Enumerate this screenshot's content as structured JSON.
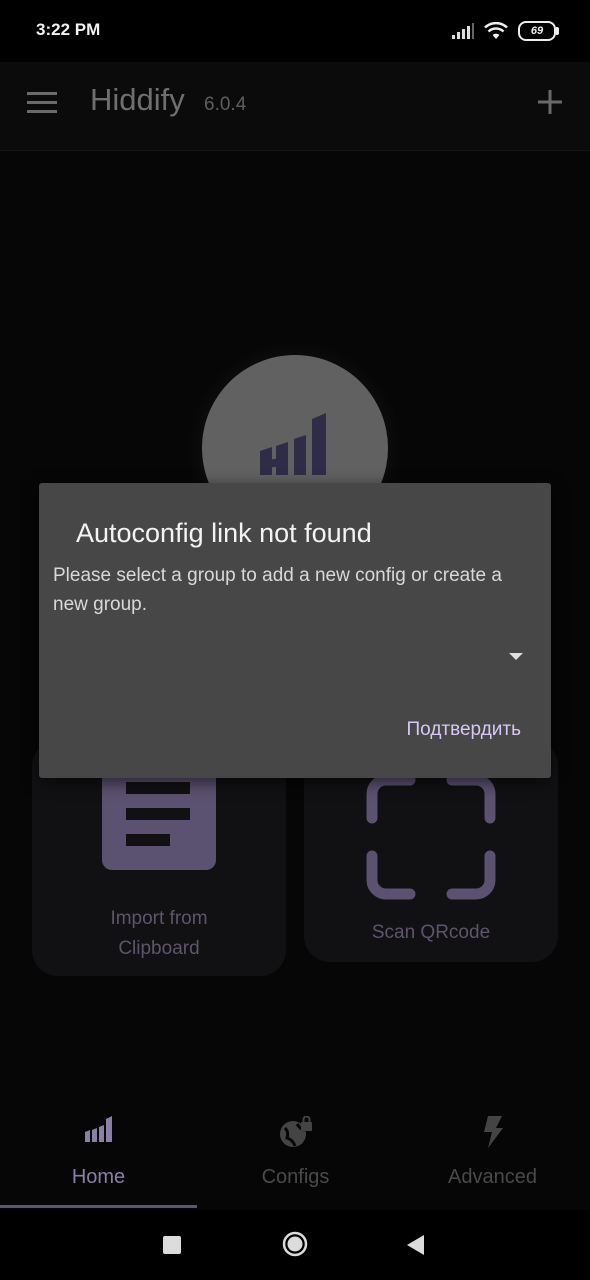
{
  "status_bar": {
    "time": "3:22 PM",
    "battery": "69"
  },
  "app_bar": {
    "title": "Hiddify",
    "version": "6.0.4"
  },
  "cards": {
    "clipboard_label_line1": "Import from",
    "clipboard_label_line2": "Clipboard",
    "qr_label": "Scan QRcode"
  },
  "dialog": {
    "title": "Autoconfig link not found",
    "message": "Please select a group to add a new config or create a new group.",
    "selected_group": "",
    "confirm_label": "Подтвердить"
  },
  "bottom_nav": {
    "items": [
      {
        "label": "Home",
        "icon": "signal-bars-icon",
        "active": true
      },
      {
        "label": "Configs",
        "icon": "globe-lock-icon",
        "active": false
      },
      {
        "label": "Advanced",
        "icon": "lightning-icon",
        "active": false
      }
    ]
  },
  "colors": {
    "accent": "#8a7fa6",
    "dialog_bg": "#474747",
    "confirm": "#d8c8f4"
  }
}
